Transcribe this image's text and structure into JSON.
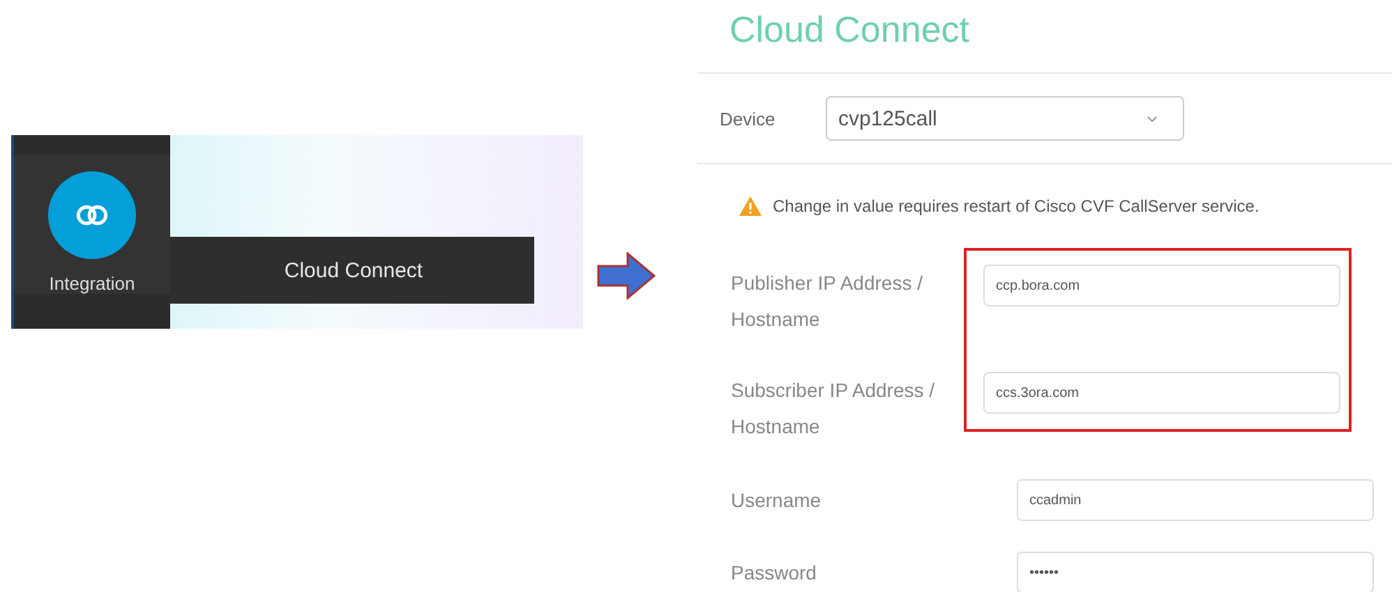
{
  "menu_panel": {
    "nav_item": {
      "label": "Integration",
      "selected": true
    },
    "flyout_item": {
      "label": "Cloud Connect"
    }
  },
  "settings_page": {
    "title": "Cloud Connect",
    "device": {
      "label": "Device",
      "value": "cvp125call"
    },
    "warning": "Change in value requires restart of Cisco CVF CallServer service.",
    "fields": [
      {
        "label": "Publisher IP Address / Hostname",
        "value": "ccp.bora.com",
        "highlighted": true
      },
      {
        "label": "Subscriber IP Address / Hostname",
        "value": "ccs.3ora.com",
        "highlighted": true
      },
      {
        "label": "Username",
        "value": "ccadmin",
        "highlighted": false
      },
      {
        "label": "Password",
        "value": "••••••",
        "highlighted": false
      }
    ]
  }
}
